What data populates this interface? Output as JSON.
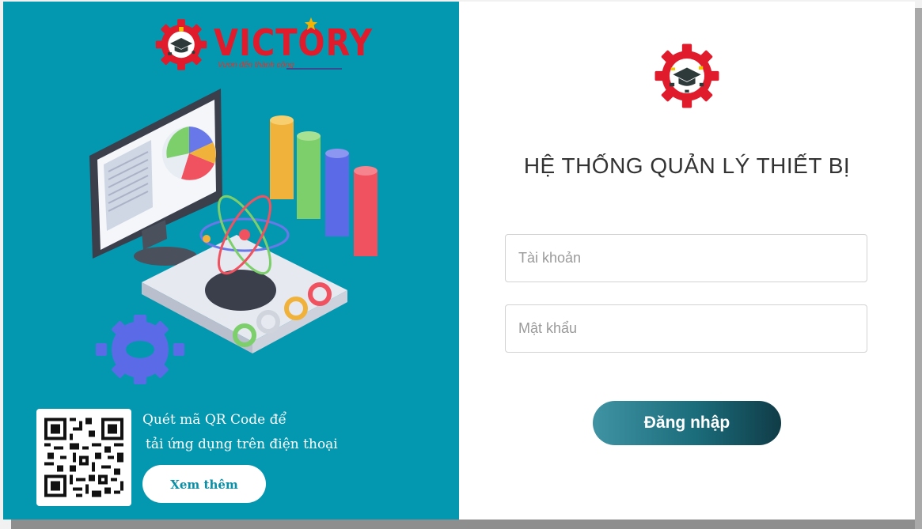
{
  "brand": {
    "name": "VICTORY",
    "tagline": "Vươn đến thành công"
  },
  "qr_section": {
    "line1": "Quét mã QR Code để",
    "line2": "tải ứng dụng trên điện thoại",
    "button_label": "Xem thêm"
  },
  "login": {
    "title": "HỆ THỐNG QUẢN LÝ THIẾT BỊ",
    "username_placeholder": "Tài khoản",
    "password_placeholder": "Mật khẩu",
    "submit_label": "Đăng nhập"
  },
  "colors": {
    "left_panel": "#0497b0",
    "brand_red": "#e01b2b",
    "button_gradient_start": "#3f93a3",
    "button_gradient_end": "#103c47"
  },
  "icons": {
    "brand_logo": "gear-graduation-cap-icon",
    "hero": "computer-science-illustration",
    "qr": "qr-code"
  }
}
